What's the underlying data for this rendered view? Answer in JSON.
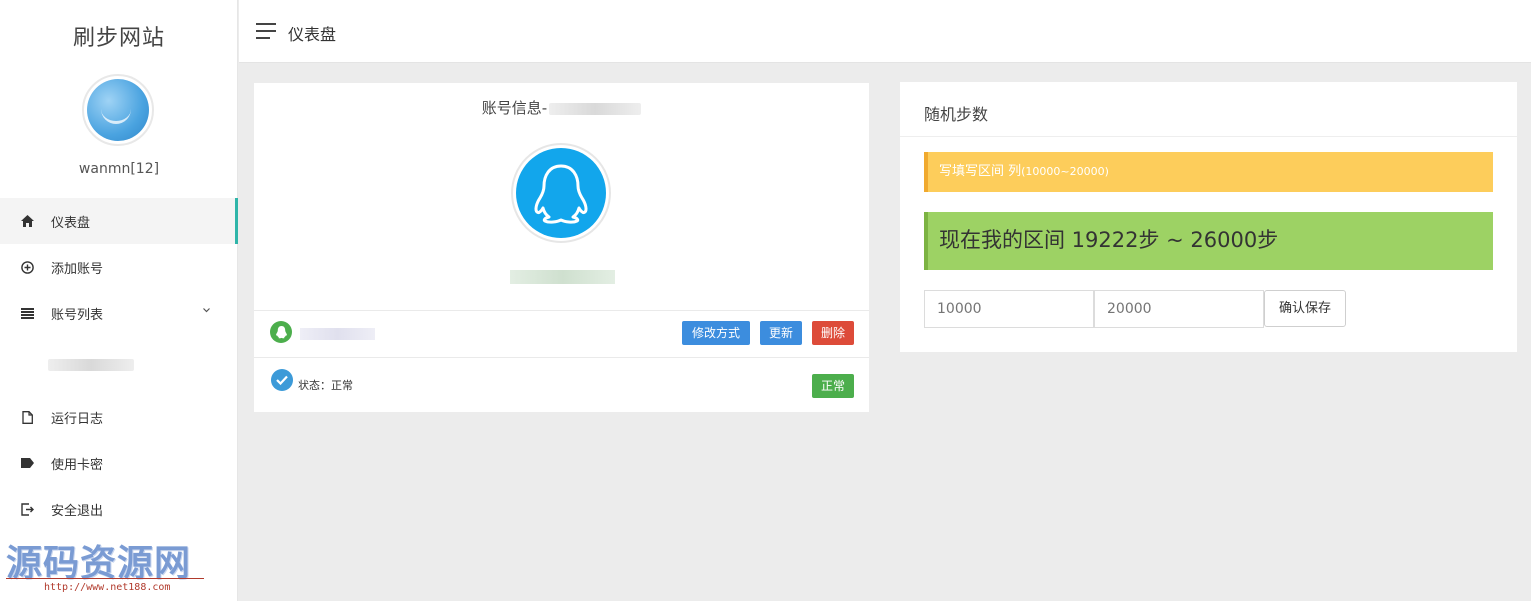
{
  "sidebar": {
    "site_title": "刷步网站",
    "username": "wanmn[12]",
    "items": [
      {
        "label": "仪表盘",
        "icon": "home-icon"
      },
      {
        "label": "添加账号",
        "icon": "plus-circle-icon"
      },
      {
        "label": "账号列表",
        "icon": "list-icon"
      },
      {
        "label": "运行日志",
        "icon": "file-icon"
      },
      {
        "label": "使用卡密",
        "icon": "tag-icon"
      },
      {
        "label": "安全退出",
        "icon": "logout-icon"
      }
    ],
    "accent_color": "#2fb5a9"
  },
  "topbar": {
    "title": "仪表盘"
  },
  "account_card": {
    "title_prefix": "账号信息-",
    "buttons": {
      "modify": "修改方式",
      "update": "更新",
      "delete": "删除",
      "status_badge": "正常"
    },
    "status_label": "状态：正常"
  },
  "steps_card": {
    "title": "随机步数",
    "alert_prefix": "写填写区间 列",
    "alert_range": "(10000~20000)",
    "current_range": "现在我的区间 19222步 ~ 26000步",
    "min_placeholder": "10000",
    "max_placeholder": "20000",
    "save_label": "确认保存"
  },
  "watermark": {
    "text": "源码资源网",
    "url": "http://www.net188.com"
  }
}
